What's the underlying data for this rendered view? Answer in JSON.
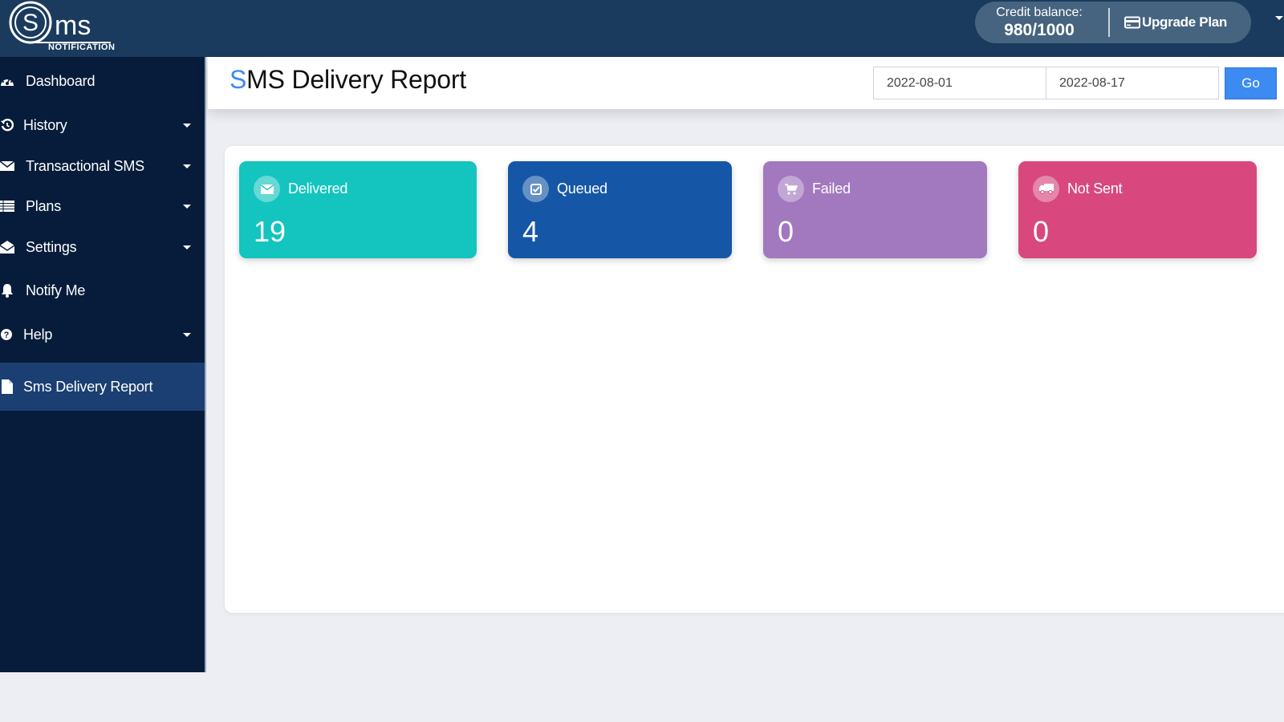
{
  "brand": {
    "logo_main": "ms",
    "logo_letter": "S",
    "logo_sub": "NOTIFICATION"
  },
  "topbar": {
    "credit_label": "Credit balance:",
    "credit_value": "980/1000",
    "upgrade_label": "Upgrade Plan"
  },
  "sidebar": {
    "items": [
      {
        "label": "Dashboard",
        "icon": "dashboard-icon",
        "has_caret": false
      },
      {
        "label": "History",
        "icon": "history-icon",
        "has_caret": true
      },
      {
        "label": "Transactional SMS",
        "icon": "envelope-icon",
        "has_caret": true
      },
      {
        "label": "Plans",
        "icon": "list-icon",
        "has_caret": true
      },
      {
        "label": "Settings",
        "icon": "envelope-open-icon",
        "has_caret": true
      },
      {
        "label": "Notify Me",
        "icon": "bell-icon",
        "has_caret": false
      },
      {
        "label": "Help",
        "icon": "question-circle-icon",
        "has_caret": true
      },
      {
        "label": "Sms Delivery Report",
        "icon": "file-icon",
        "has_caret": false,
        "active": true
      }
    ]
  },
  "header": {
    "title_accent": "S",
    "title_rest": "MS Delivery Report",
    "date_from": "2022-08-01",
    "date_to": "2022-08-17",
    "go_label": "Go"
  },
  "stats": [
    {
      "label": "Delivered",
      "value": "19",
      "icon": "envelope-icon",
      "color": "#14c4bf"
    },
    {
      "label": "Queued",
      "value": "4",
      "icon": "check-square-icon",
      "color": "#1557a6"
    },
    {
      "label": "Failed",
      "value": "0",
      "icon": "cart-icon",
      "color": "#a278be"
    },
    {
      "label": "Not Sent",
      "value": "0",
      "icon": "truck-icon",
      "color": "#d8487e"
    }
  ]
}
